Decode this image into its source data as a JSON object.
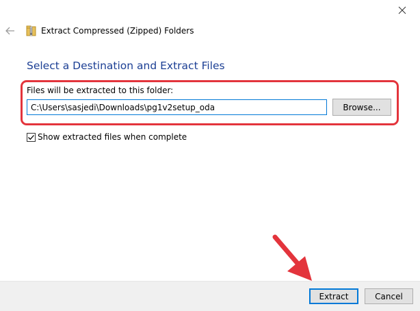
{
  "window": {
    "title": "Extract Compressed (Zipped) Folders",
    "close_icon": "close-icon",
    "back_icon": "back-arrow-icon",
    "app_icon": "zip-folder-icon"
  },
  "main": {
    "heading": "Select a Destination and Extract Files",
    "destination_label": "Files will be extracted to this folder:",
    "destination_path": "C:\\Users\\sasjedi\\Downloads\\pg1v2setup_oda",
    "browse_label": "Browse...",
    "show_files_label": "Show extracted files when complete",
    "show_files_checked": true
  },
  "footer": {
    "extract_label": "Extract",
    "cancel_label": "Cancel"
  },
  "annotations": {
    "highlight_color": "#e3343c",
    "arrow_color": "#e3343c"
  },
  "colors": {
    "heading": "#1c3f94",
    "accent": "#0078d7"
  }
}
